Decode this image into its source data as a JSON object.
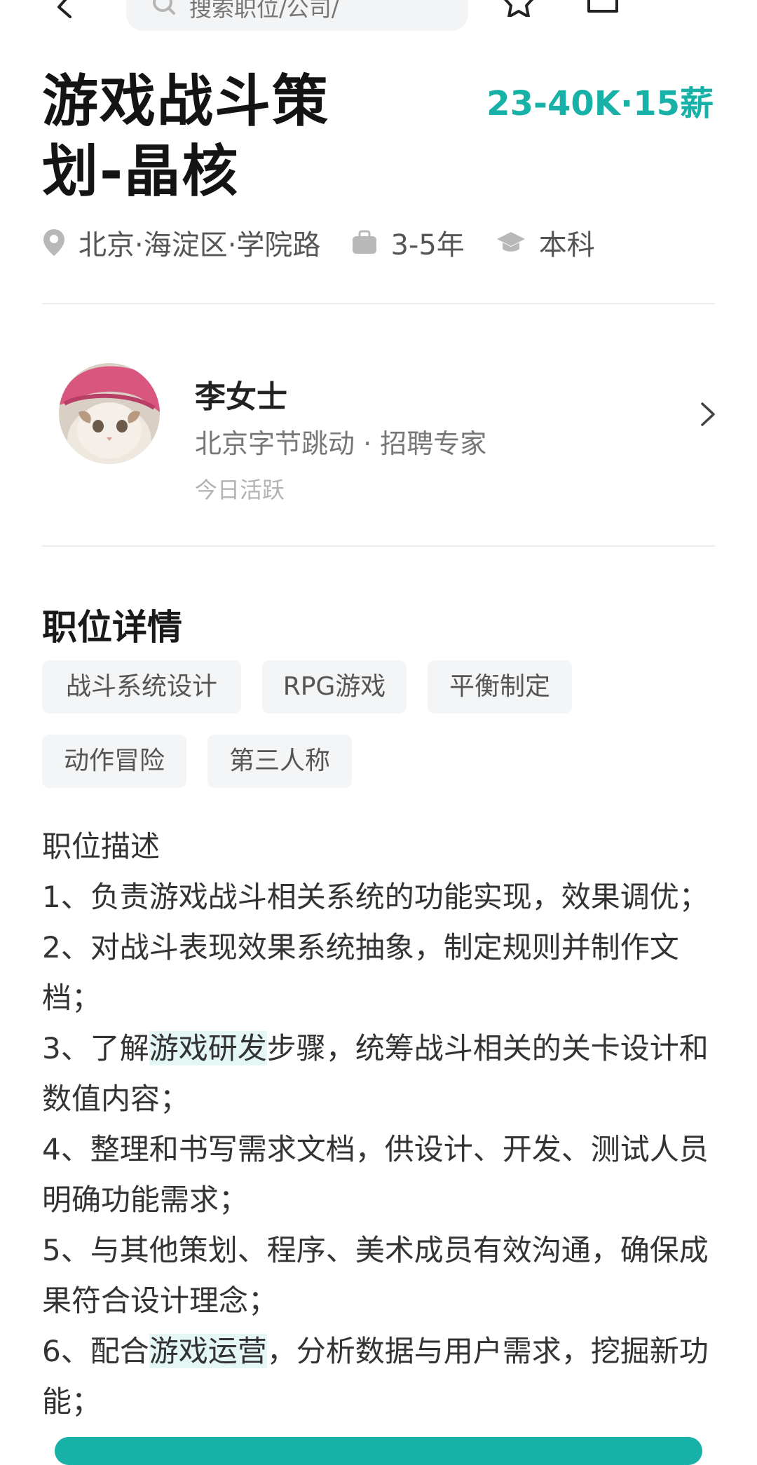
{
  "header": {
    "search_placeholder": "搜索职位/公司/"
  },
  "job": {
    "title": "游戏战斗策划-晶核",
    "salary": "23-40K·15薪",
    "location": "北京·海淀区·学院路",
    "experience": "3-5年",
    "education": "本科"
  },
  "recruiter": {
    "name": "李女士",
    "company_role": "北京字节跳动 · 招聘专家",
    "status": "今日活跃"
  },
  "details": {
    "section_title": "职位详情",
    "tags": [
      "战斗系统设计",
      "RPG游戏",
      "平衡制定",
      "动作冒险",
      "第三人称"
    ],
    "description": {
      "heading": "职位描述",
      "line1": "1、负责游戏战斗相关系统的功能实现，效果调优；",
      "line2": "2、对战斗表现效果系统抽象，制定规则并制作文档；",
      "line3_pre": "3、了解",
      "line3_hl": "游戏研发",
      "line3_post": "步骤，统筹战斗相关的关卡设计和数值内容；",
      "line4": "4、整理和书写需求文档，供设计、开发、测试人员明确功能需求；",
      "line5": "5、与其他策划、程序、美术成员有效沟通，确保成果符合设计理念；",
      "line6_pre": "6、配合",
      "line6_hl": "游戏运营",
      "line6_post": "，分析数据与用户需求，挖掘新功能；"
    }
  },
  "colors": {
    "accent": "#17b1a8",
    "highlight_bg": "#e4f7f4",
    "tag_bg": "#f4f5f6"
  }
}
